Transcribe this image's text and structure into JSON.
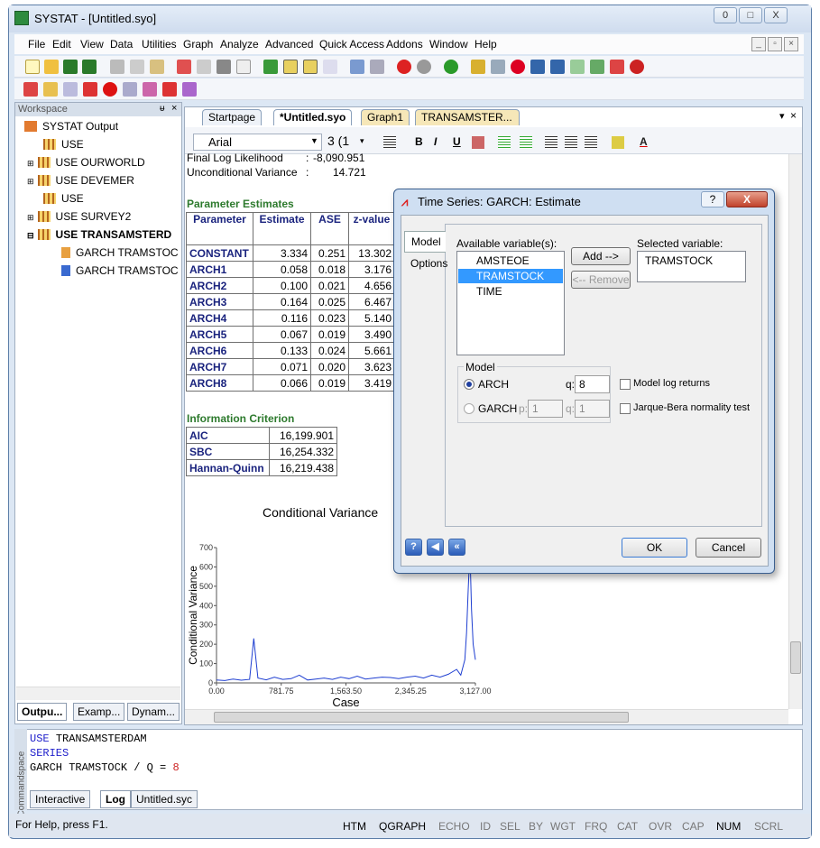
{
  "window": {
    "title": "SYSTAT - [Untitled.syo]",
    "minimize_glyph": "0",
    "restore_glyph": "□",
    "close_glyph": "X"
  },
  "menu": [
    "File",
    "Edit",
    "View",
    "Data",
    "Utilities",
    "Graph",
    "Analyze",
    "Advanced",
    "Quick Access",
    "Addons",
    "Window",
    "Help"
  ],
  "workspace": {
    "title": "Workspace",
    "root": "SYSTAT Output",
    "items": [
      "USE",
      "USE OURWORLD",
      "USE DEVEMER",
      "USE",
      "USE SURVEY2",
      "USE TRANSAMSTERD",
      "GARCH TRAMSTOC",
      "GARCH TRAMSTOC"
    ],
    "tabs": [
      "Outpu...",
      "Examp...",
      "Dynam..."
    ]
  },
  "doc_tabs": [
    "Startpage",
    "*Untitled.syo",
    "Graph1",
    "TRANSAMSTER..."
  ],
  "format": {
    "font": "Arial",
    "size": "3 (1"
  },
  "output": {
    "final_ll_label": "Final Log Likelihood",
    "final_ll_value": "-8,090.951",
    "uncond_label": "Unconditional Variance",
    "uncond_value": "14.721",
    "param_title": "Parameter Estimates",
    "param_headers": [
      "Parameter",
      "Estimate",
      "ASE",
      "z-value"
    ],
    "params": [
      [
        "CONSTANT",
        "3.334",
        "0.251",
        "13.302"
      ],
      [
        "ARCH1",
        "0.058",
        "0.018",
        "3.176"
      ],
      [
        "ARCH2",
        "0.100",
        "0.021",
        "4.656"
      ],
      [
        "ARCH3",
        "0.164",
        "0.025",
        "6.467"
      ],
      [
        "ARCH4",
        "0.116",
        "0.023",
        "5.140"
      ],
      [
        "ARCH5",
        "0.067",
        "0.019",
        "3.490"
      ],
      [
        "ARCH6",
        "0.133",
        "0.024",
        "5.661"
      ],
      [
        "ARCH7",
        "0.071",
        "0.020",
        "3.623"
      ],
      [
        "ARCH8",
        "0.066",
        "0.019",
        "3.419"
      ]
    ],
    "info_title": "Information Criterion",
    "info": [
      [
        "AIC",
        "16,199.901"
      ],
      [
        "SBC",
        "16,254.332"
      ],
      [
        "Hannan-Quinn",
        "16,219.438"
      ]
    ]
  },
  "chart_data": {
    "type": "line",
    "title": "Conditional Variance",
    "xlabel": "Case",
    "ylabel": "Conditional Variance",
    "xlim": [
      0,
      3127
    ],
    "ylim": [
      0,
      700
    ],
    "xticks": [
      "0.00",
      "781.75",
      "1,563.50",
      "2,345.25",
      "3,127.00"
    ],
    "yticks": [
      "0",
      "100",
      "200",
      "300",
      "400",
      "500",
      "600",
      "700"
    ],
    "x": [
      0,
      100,
      200,
      300,
      400,
      450,
      500,
      600,
      700,
      800,
      900,
      1000,
      1100,
      1200,
      1300,
      1400,
      1500,
      1600,
      1700,
      1800,
      1900,
      2000,
      2100,
      2200,
      2300,
      2400,
      2500,
      2600,
      2700,
      2800,
      2900,
      2950,
      3000,
      3020,
      3040,
      3060,
      3080,
      3100,
      3127
    ],
    "y": [
      15,
      12,
      20,
      14,
      18,
      230,
      25,
      16,
      30,
      18,
      22,
      40,
      15,
      20,
      25,
      18,
      30,
      22,
      35,
      20,
      25,
      30,
      28,
      22,
      30,
      35,
      25,
      40,
      30,
      45,
      70,
      40,
      120,
      260,
      480,
      690,
      380,
      200,
      120
    ]
  },
  "command": {
    "lines": [
      {
        "kw": "USE",
        "rest": "TRANSAMSTERDAM"
      },
      {
        "kw": "SERIES",
        "rest": ""
      },
      {
        "kw": "",
        "rest": "GARCH TRAMSTOCK / Q = ",
        "num": "8"
      }
    ],
    "label": "Commandspace",
    "tabs": [
      "Interactive",
      "Log",
      "Untitled.syc"
    ]
  },
  "status": {
    "text": "For Help, press F1.",
    "indicators": [
      "HTM",
      "QGRAPH",
      "ECHO",
      "ID",
      "SEL",
      "BY",
      "WGT",
      "FRQ",
      "CAT",
      "OVR",
      "CAP",
      "NUM",
      "SCRL"
    ]
  },
  "dialog": {
    "title": "Time Series: GARCH: Estimate",
    "help_glyph": "?",
    "close_glyph": "X",
    "side_tabs": [
      "Model",
      "Options"
    ],
    "available_label": "Available variable(s):",
    "available": [
      "AMSTEOE",
      "TRAMSTOCK",
      "TIME"
    ],
    "selected_index": 1,
    "add_label": "Add -->",
    "remove_label": "<-- Remove",
    "selected_label": "Selected variable:",
    "selected_value": "TRAMSTOCK",
    "model_group": "Model",
    "arch_label": "ARCH",
    "q_label": "q:",
    "q_value": "8",
    "garch_label": "GARCH",
    "p_label": "p:",
    "p_value": "1",
    "q2_label": "q:",
    "q2_value": "1",
    "log_returns": "Model log returns",
    "jarque": "Jarque-Bera normality test",
    "ok": "OK",
    "cancel": "Cancel"
  },
  "colors": {
    "accent": "#2d7a2d",
    "header": "#1a237e",
    "series": "#1f3fd1",
    "keyword": "#2222cc",
    "number": "#cc2222"
  }
}
